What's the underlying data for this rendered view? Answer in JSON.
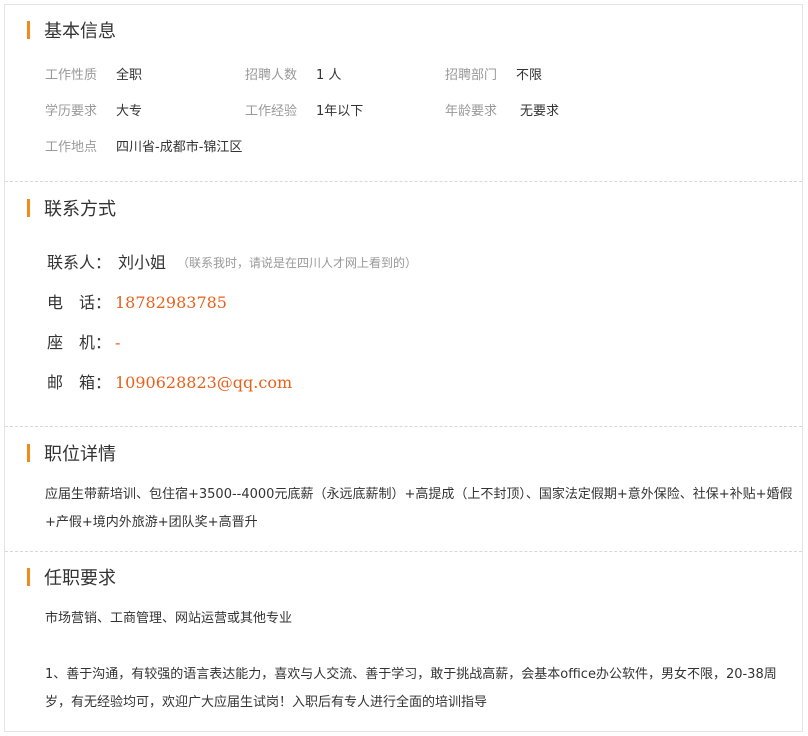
{
  "basic": {
    "title": "基本信息",
    "job_type_label": "工作性质",
    "job_type": "全职",
    "headcount_label": "招聘人数",
    "headcount": "1 人",
    "dept_label": "招聘部门",
    "dept": "不限",
    "education_label": "学历要求",
    "education": "大专",
    "experience_label": "工作经验",
    "experience": "1年以下",
    "age_label": "年龄要求",
    "age": "无要求",
    "location_label": "工作地点",
    "location": "四川省-成都市-锦江区"
  },
  "contact": {
    "title": "联系方式",
    "person_label": "联系人：",
    "person": "刘小姐",
    "note_open": "（",
    "note": "联系我时，请说是在四川人才网上看到的",
    "note_close": "）",
    "phone_label": "电　话：",
    "phone": "18782983785",
    "landline_label": "座　机：",
    "landline": "-",
    "email_label": "邮　箱：",
    "email": "1090628823@qq.com"
  },
  "details": {
    "title": "职位详情",
    "text": "应届生带薪培训、包住宿+3500--4000元底薪（永远底薪制）+高提成（上不封顶）、国家法定假期+意外保险、社保+补贴+婚假+产假+境内外旅游+团队奖+高晋升"
  },
  "requirements": {
    "title": "任职要求",
    "majors": "市场营销、工商管理、网站运营或其他专业",
    "text": "1、善于沟通，有较强的语言表达能力，喜欢与人交流、善于学习，敢于挑战高薪，会基本office办公软件，男女不限，20-38周岁，有无经验均可，欢迎广大应届生试岗！入职后有专人进行全面的培训指导"
  },
  "colors": {
    "accent_bar": "#f08a1c",
    "highlight": "#e8611c"
  }
}
